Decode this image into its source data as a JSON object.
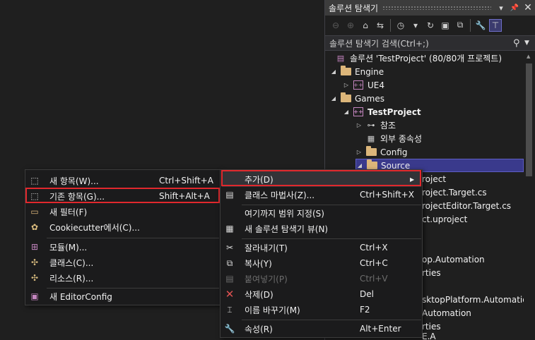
{
  "panel": {
    "title": "솔루션 탐색기",
    "search_placeholder": "솔루션 탐색기 검색(Ctrl+;)"
  },
  "tree": {
    "solution": "솔루션 'TestProject' (80/80개 프로젝트)",
    "engine": "Engine",
    "ue4": "UE4",
    "games": "Games",
    "testproject": "TestProject",
    "references": "참조",
    "external_deps": "외부 종속성",
    "config": "Config",
    "source": "Source",
    "partial_1": "roject",
    "partial_2": "roject.Target.cs",
    "partial_3": "rojectEditor.Target.cs",
    "partial_4": "ct.uproject",
    "partial_5": "op.Automation",
    "partial_6": "rties",
    "partial_7": "sktopPlatform.Automation",
    "partial_8": "Automation",
    "partial_9": "rties",
    "partial_10": "E.A"
  },
  "add_menu": {
    "items": [
      {
        "label": "새 항목(W)...",
        "shortcut": "Ctrl+Shift+A"
      },
      {
        "label": "기존 항목(G)...",
        "shortcut": "Shift+Alt+A"
      },
      {
        "label": "새 필터(F)",
        "shortcut": ""
      },
      {
        "label": "Cookiecutter에서(C)...",
        "shortcut": ""
      },
      {
        "label": "모듈(M)...",
        "shortcut": ""
      },
      {
        "label": "클래스(C)...",
        "shortcut": ""
      },
      {
        "label": "리소스(R)...",
        "shortcut": ""
      },
      {
        "label": "새 EditorConfig",
        "shortcut": ""
      }
    ]
  },
  "context_menu": {
    "items": [
      {
        "label": "추가(D)",
        "shortcut": ""
      },
      {
        "label": "클래스 마법사(Z)...",
        "shortcut": "Ctrl+Shift+X"
      },
      {
        "label": "여기까지 범위 지정(S)",
        "shortcut": ""
      },
      {
        "label": "새 솔루션 탐색기 뷰(N)",
        "shortcut": ""
      },
      {
        "label": "잘라내기(T)",
        "shortcut": "Ctrl+X"
      },
      {
        "label": "복사(Y)",
        "shortcut": "Ctrl+C"
      },
      {
        "label": "붙여넣기(P)",
        "shortcut": "Ctrl+V"
      },
      {
        "label": "삭제(D)",
        "shortcut": "Del"
      },
      {
        "label": "이름 바꾸기(M)",
        "shortcut": "F2"
      },
      {
        "label": "속성(R)",
        "shortcut": "Alt+Enter"
      }
    ]
  },
  "colors": {
    "highlight_border": "#e0282d",
    "selection": "#3a3a8c",
    "folder": "#dcb67a",
    "project": "#c586c0"
  }
}
